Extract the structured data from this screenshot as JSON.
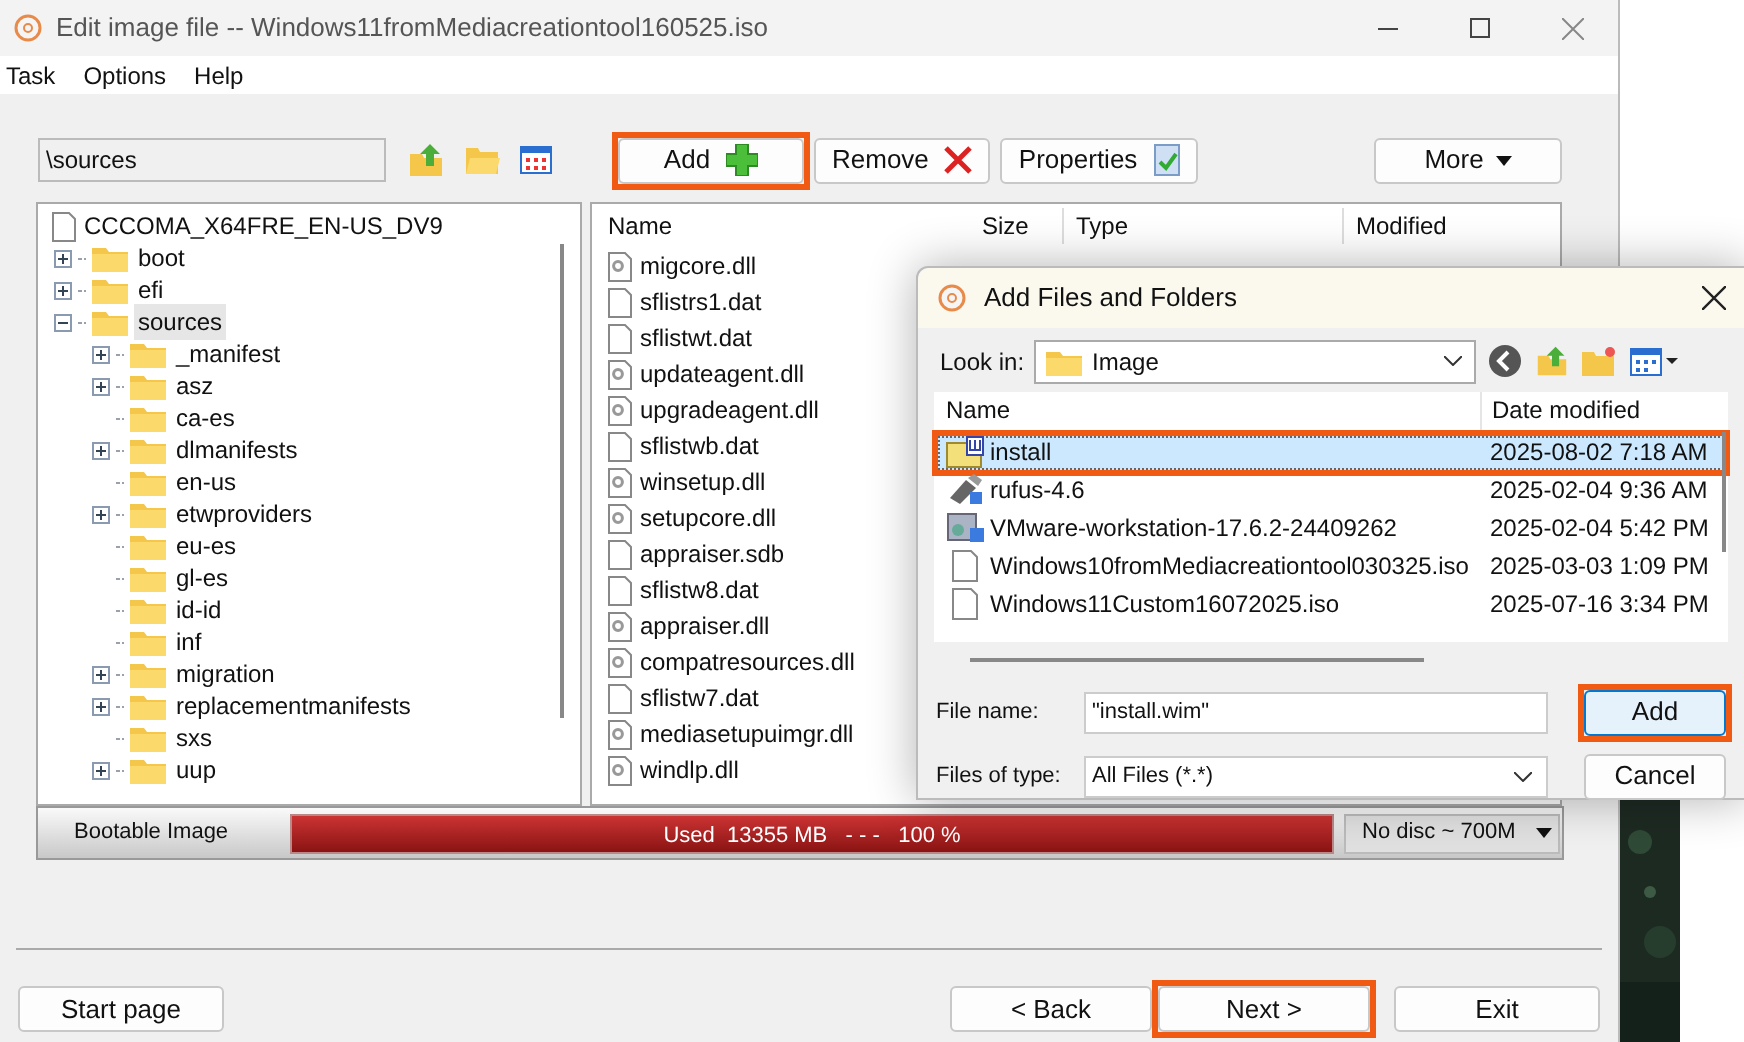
{
  "window": {
    "title": "Edit image file -- Windows11fromMediacreationtool160525.iso"
  },
  "menu": [
    "Task",
    "Options",
    "Help"
  ],
  "path_field": {
    "value": "\\sources"
  },
  "toolbar_buttons": [
    {
      "label": "Add",
      "kind": "add",
      "highlighted": true
    },
    {
      "label": "Remove",
      "kind": "remove",
      "highlighted": false
    },
    {
      "label": "Properties",
      "kind": "properties",
      "highlighted": false
    }
  ],
  "more_button": {
    "label": "More"
  },
  "tree": {
    "label": "CCCOMA_X64FRE_EN-US_DV9",
    "children": [
      {
        "label": "boot",
        "kind": "branch",
        "expanded": false,
        "selected": false
      },
      {
        "label": "efi",
        "kind": "branch",
        "expanded": false,
        "selected": false
      },
      {
        "label": "sources",
        "kind": "branch",
        "expanded": true,
        "selected": true,
        "children": [
          {
            "label": "_manifest",
            "kind": "branch",
            "expanded": false,
            "selected": false
          },
          {
            "label": "asz",
            "kind": "branch",
            "expanded": false,
            "selected": false
          },
          {
            "label": "ca-es",
            "kind": "leaf",
            "selected": false
          },
          {
            "label": "dlmanifests",
            "kind": "branch",
            "expanded": false,
            "selected": false
          },
          {
            "label": "en-us",
            "kind": "leaf",
            "selected": false
          },
          {
            "label": "etwproviders",
            "kind": "branch",
            "expanded": false,
            "selected": false
          },
          {
            "label": "eu-es",
            "kind": "leaf",
            "selected": false
          },
          {
            "label": "gl-es",
            "kind": "leaf",
            "selected": false
          },
          {
            "label": "id-id",
            "kind": "leaf",
            "selected": false
          },
          {
            "label": "inf",
            "kind": "leaf",
            "selected": false
          },
          {
            "label": "migration",
            "kind": "branch",
            "expanded": false,
            "selected": false
          },
          {
            "label": "replacementmanifests",
            "kind": "branch",
            "expanded": false,
            "selected": false
          },
          {
            "label": "sxs",
            "kind": "leaf",
            "selected": false
          },
          {
            "label": "uup",
            "kind": "branch",
            "expanded": false,
            "selected": false
          }
        ]
      }
    ]
  },
  "file_list": {
    "columns": [
      "Name",
      "Size",
      "Type",
      "Modified"
    ],
    "rows": [
      {
        "name": "migcore.dll",
        "kind": "library"
      },
      {
        "name": "sflistrs1.dat",
        "kind": "data"
      },
      {
        "name": "sflistwt.dat",
        "kind": "data"
      },
      {
        "name": "updateagent.dll",
        "kind": "library"
      },
      {
        "name": "upgradeagent.dll",
        "kind": "library"
      },
      {
        "name": "sflistwb.dat",
        "kind": "data"
      },
      {
        "name": "winsetup.dll",
        "kind": "library"
      },
      {
        "name": "setupcore.dll",
        "kind": "library"
      },
      {
        "name": "appraiser.sdb",
        "kind": "data"
      },
      {
        "name": "sflistw8.dat",
        "kind": "data"
      },
      {
        "name": "appraiser.dll",
        "kind": "library"
      },
      {
        "name": "compatresources.dll",
        "kind": "library"
      },
      {
        "name": "sflistw7.dat",
        "kind": "data"
      },
      {
        "name": "mediasetupuimgr.dll",
        "kind": "library"
      },
      {
        "name": "windlp.dll",
        "kind": "library"
      }
    ]
  },
  "status_bar": {
    "label": "Bootable Image",
    "usage": "Used  13355 MB   - - -   100 %",
    "level": 1,
    "disc": "No disc ~ 700M"
  },
  "bottom_buttons": [
    {
      "label": "Start page",
      "highlighted": false
    },
    {
      "label": "< Back",
      "highlighted": false
    },
    {
      "label": "Next >",
      "highlighted": true
    },
    {
      "label": "Exit",
      "highlighted": false
    }
  ],
  "dialog": {
    "title": "Add Files and Folders",
    "look_in_label": "Look in:",
    "look_in": "Image",
    "columns": [
      "Name",
      "Date modified"
    ],
    "rows": [
      {
        "name": "install",
        "date": "2025-08-02 7:18 AM",
        "kind": "wim",
        "selected": true,
        "highlighted": true
      },
      {
        "name": "rufus-4.6",
        "date": "2025-02-04 9:36 AM",
        "kind": "usb",
        "selected": false,
        "highlighted": false
      },
      {
        "name": "VMware-workstation-17.6.2-24409262",
        "date": "2025-02-04 5:42 PM",
        "kind": "installer",
        "selected": false,
        "highlighted": false
      },
      {
        "name": "Windows10fromMediacreationtool030325.iso",
        "date": "2025-03-03 1:09 PM",
        "kind": "file",
        "selected": false,
        "highlighted": false
      },
      {
        "name": "Windows11Custom16072025.iso",
        "date": "2025-07-16 3:34 PM",
        "kind": "file",
        "selected": false,
        "highlighted": false
      }
    ],
    "file_name_label": "File name:",
    "file_name": "\"install.wim\"",
    "file_type_label": "Files of type:",
    "file_type": "All Files (*.*)",
    "buttons": [
      {
        "label": "Add",
        "highlighted": true
      },
      {
        "label": "Cancel",
        "highlighted": false
      }
    ]
  }
}
